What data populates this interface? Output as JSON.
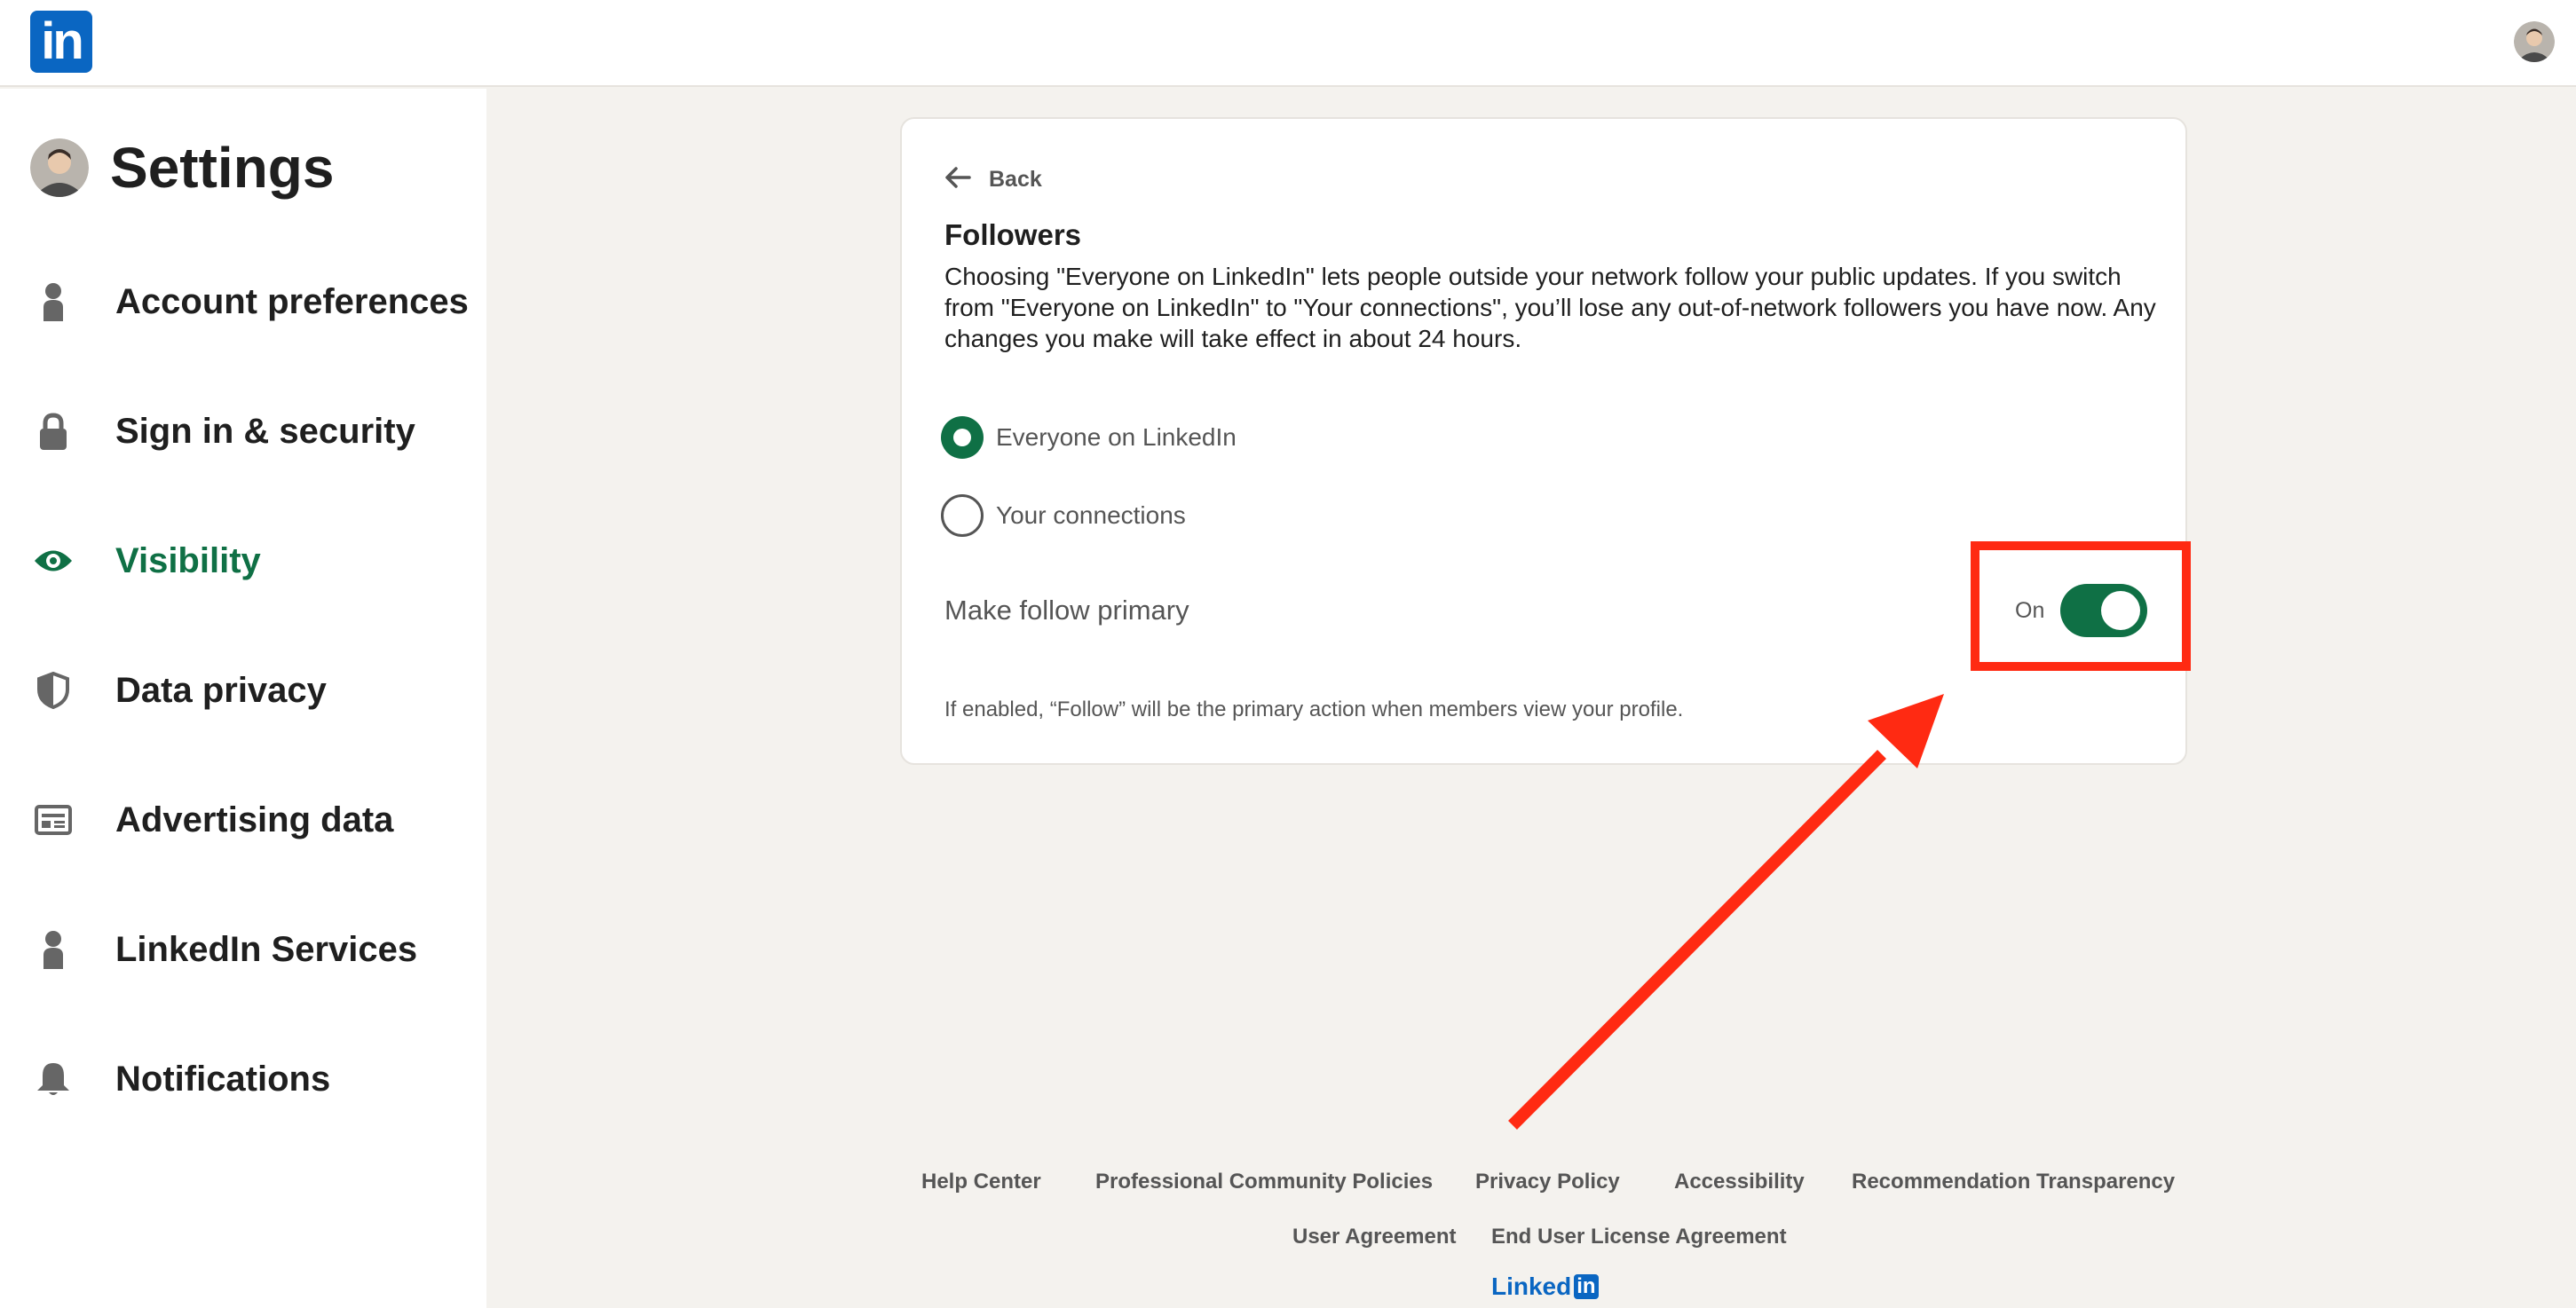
{
  "app": {
    "logo_text": "in",
    "brand_color": "#0a66c2",
    "accent_color": "#0f7045",
    "annotation_color": "#ff2a12"
  },
  "sidebar": {
    "title": "Settings",
    "items": [
      {
        "label": "Account preferences",
        "icon": "person-icon",
        "active": false
      },
      {
        "label": "Sign in & security",
        "icon": "lock-icon",
        "active": false
      },
      {
        "label": "Visibility",
        "icon": "eye-icon",
        "active": true
      },
      {
        "label": "Data privacy",
        "icon": "shield-icon",
        "active": false
      },
      {
        "label": "Advertising data",
        "icon": "ad-card-icon",
        "active": false
      },
      {
        "label": "LinkedIn Services",
        "icon": "person-icon",
        "active": false
      },
      {
        "label": "Notifications",
        "icon": "bell-icon",
        "active": false
      }
    ]
  },
  "card": {
    "back_label": "Back",
    "title": "Followers",
    "description": "Choosing \"Everyone on LinkedIn\" lets people outside your network follow your public updates. If you switch from \"Everyone on LinkedIn\" to \"Your connections\", you’ll lose any out-of-network followers you have now. Any changes you make will take effect in about 24 hours.",
    "options": [
      {
        "label": "Everyone on LinkedIn",
        "selected": true
      },
      {
        "label": "Your connections",
        "selected": false
      }
    ],
    "toggle_label": "Make follow primary",
    "toggle_state": "On",
    "toggle_on": true,
    "hint": "If enabled, “Follow” will be the primary action when members view your profile."
  },
  "footer": {
    "links_row1": [
      "Help Center",
      "Professional Community Policies",
      "Privacy Policy",
      "Accessibility",
      "Recommendation Transparency"
    ],
    "links_row2": [
      "User Agreement",
      "End User License Agreement"
    ],
    "brand_text": "Linked",
    "brand_in": "in"
  }
}
